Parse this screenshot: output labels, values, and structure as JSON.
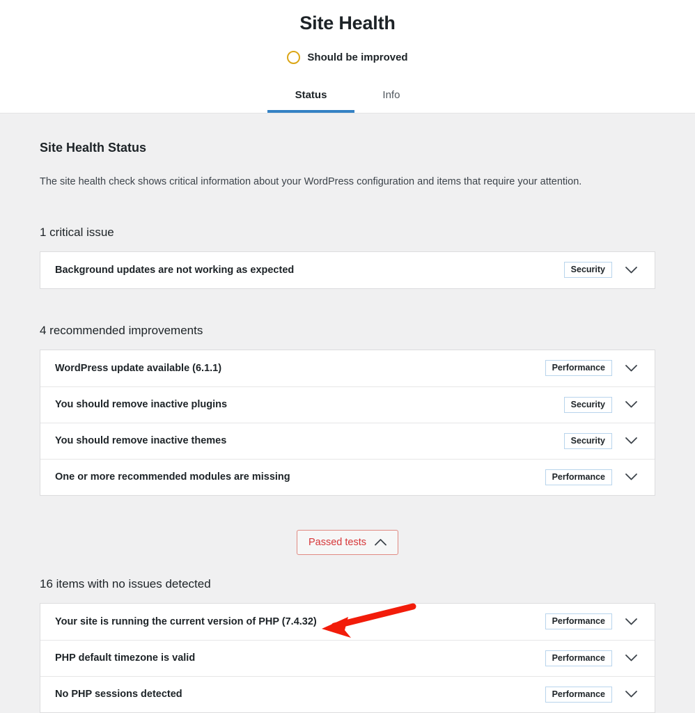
{
  "header": {
    "title": "Site Health",
    "status_label": "Should be improved",
    "status_icon": "circle-outline-icon",
    "status_color": "#dba617",
    "tabs": [
      {
        "label": "Status",
        "active": true
      },
      {
        "label": "Info",
        "active": false
      }
    ],
    "active_tab_color": "#3582c4"
  },
  "main": {
    "section_title": "Site Health Status",
    "description": "The site health check shows critical information about your WordPress configuration and items that require your attention.",
    "groups": [
      {
        "heading": "1 critical issue",
        "rows": [
          {
            "label": "Background updates are not working as expected",
            "badge": "Security",
            "chevron": "chevron-down-icon"
          }
        ]
      },
      {
        "heading": "4 recommended improvements",
        "rows": [
          {
            "label": "WordPress update available (6.1.1)",
            "badge": "Performance",
            "chevron": "chevron-down-icon"
          },
          {
            "label": "You should remove inactive plugins",
            "badge": "Security",
            "chevron": "chevron-down-icon"
          },
          {
            "label": "You should remove inactive themes",
            "badge": "Security",
            "chevron": "chevron-down-icon"
          },
          {
            "label": "One or more recommended modules are missing",
            "badge": "Performance",
            "chevron": "chevron-down-icon"
          }
        ]
      },
      {
        "heading": "16 items with no issues detected",
        "rows": [
          {
            "label": "Your site is running the current version of PHP (7.4.32)",
            "badge": "Performance",
            "chevron": "chevron-down-icon"
          },
          {
            "label": "PHP default timezone is valid",
            "badge": "Performance",
            "chevron": "chevron-down-icon"
          },
          {
            "label": "No PHP sessions detected",
            "badge": "Performance",
            "chevron": "chevron-down-icon"
          }
        ]
      }
    ],
    "passed_tests_button": {
      "label": "Passed tests",
      "icon": "chevron-up-icon",
      "color": "#d63638"
    }
  },
  "annotation": {
    "type": "arrow",
    "color": "#f21c0a",
    "points_at": "Your site is running the current version of PHP (7.4.32)"
  },
  "badge_border_color": "#b8d4ec"
}
